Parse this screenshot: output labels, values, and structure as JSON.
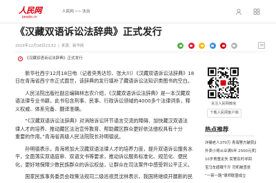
{
  "header": {
    "logo_text": "人民网",
    "logo_sub": "people.cn",
    "breadcrumb": [
      "人民网",
      "法治"
    ],
    "breadcrumb_sep": ">>",
    "icons": {
      "user": "user-icon",
      "apps": "grid-icon"
    }
  },
  "article": {
    "title": "《汉藏双语诉讼法辞典》正式发行",
    "date": "2019年12月18日23:52",
    "meta_sep": "|",
    "source_label": "来源：",
    "source": "新华网",
    "share_icons": [
      {
        "name": "wechat-icon",
        "color": "#4cae3c"
      },
      {
        "name": "weibo-icon",
        "color": "#e6162d"
      },
      {
        "name": "qzone-icon",
        "color": "#f7b700"
      },
      {
        "name": "qq-icon",
        "color": "#3d8ce4"
      },
      {
        "name": "people-weibo-icon",
        "color": "#d7000f"
      },
      {
        "name": "more-share-icon",
        "color": "#b5b5b5"
      }
    ],
    "tool_icon": "print-icon",
    "audio_icon": "audio-play-icon",
    "audio_title": "《汉藏双语诉讼法辞典》正式发行",
    "paragraphs": [
      [
        "新华社西宁12月18日电（记者央秀达珍、张大川）《汉藏双语诉讼法辞典》18",
        "日在青海省西宁市正式面世，该辞典的发行填补了藏语诉讼法知识类图书的空白。"
      ],
      [
        "人民法院出版社副总编辑林志农介绍，《汉藏双语诉讼法辞典》是一本汉藏双",
        "语法律专业书籍，此书包含刑事、民事、行政诉讼领域的4000多个法律词条，释",
        "义权威、体系完备、翻译准确。"
      ],
      [
        "“《汉藏双语诉讼法辞典》对消除诉讼环节语言交流的障碍、加快藏汉双语法",
        "律人才的培养、推动藏区法治宣传教育、帮助藏区群众更好依法维权具有十分",
        "重要的作用。”青海省高级人民法院院长孙明德说。"
      ],
      [
        "孙明德表示，青海将加大汉藏双语法律人才的培养力度，提升双语诉讼服务水",
        "平，全面落实双语庭审、双语文书等要求，推动诉讼服务标准化、规范化、便民",
        "化，更好地保障少数民族群众的诉讼权益，让群众在司法案件中感受到公平正义。"
      ],
      [
        "国家民族事务委员会政策法规司二级巡视员沈林表示，我国将继续开展新的民"
      ]
    ]
  },
  "sidebar": {
    "qr_caption": "关注人民网微信",
    "app_button": "下载人民网客户端",
    "hot_title": "热点推荐",
    "hot_items": [
      "诈骗老人370万 青海警方破获此案",
      "外卖小哥从业满5年 2500元奖励",
      "10岁男童走失 民警及时寻回",
      "宝马车超载千斤 司机被查处",
      "“一带一路”律师联盟成立"
    ]
  },
  "colors": {
    "brand_red": "#d7000f",
    "title_text": "#222222",
    "body_text": "#333333",
    "muted_text": "#8f8f8f",
    "divider": "#e8e8e8"
  }
}
